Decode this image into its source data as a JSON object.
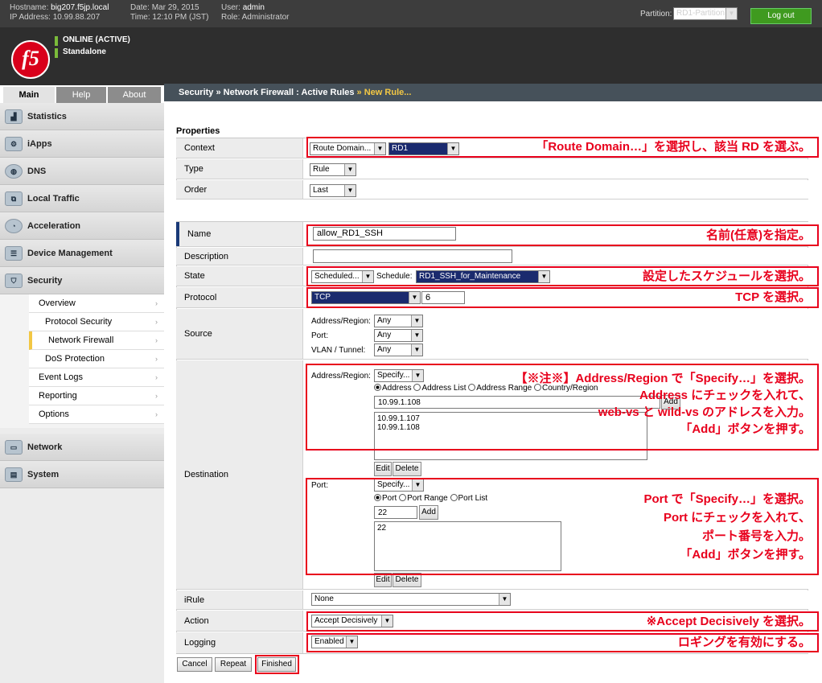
{
  "header": {
    "hostname_label": "Hostname:",
    "hostname": "big207.f5jp.local",
    "ip_label": "IP Address:",
    "ip": "10.99.88.207",
    "date_label": "Date:",
    "date": "Mar 29, 2015",
    "time_label": "Time:",
    "time": "12:10 PM (JST)",
    "user_label": "User:",
    "user": "admin",
    "role_label": "Role:",
    "role": "Administrator",
    "partition_label": "Partition:",
    "partition": "RD1-Partition",
    "logout": "Log out",
    "logo": "f5",
    "status1": "ONLINE (ACTIVE)",
    "status2": "Standalone"
  },
  "tabs": [
    "Main",
    "Help",
    "About"
  ],
  "breadcrumb": {
    "a": "Security",
    "sep1": "»",
    "b": "Network Firewall : Active Rules",
    "sep2": "»",
    "c": "New Rule..."
  },
  "sidebar": {
    "items": [
      "Statistics",
      "iApps",
      "DNS",
      "Local Traffic",
      "Acceleration",
      "Device Management",
      "Security",
      "Network",
      "System"
    ],
    "sub": [
      "Overview",
      "Protocol Security",
      "Network Firewall",
      "DoS Protection",
      "Event Logs",
      "Reporting",
      "Options"
    ]
  },
  "form": {
    "section": "Properties",
    "context": {
      "label": "Context",
      "select1": "Route Domain...",
      "select2": "RD1"
    },
    "type": {
      "label": "Type",
      "value": "Rule"
    },
    "order": {
      "label": "Order",
      "value": "Last"
    },
    "name": {
      "label": "Name",
      "value": "allow_RD1_SSH"
    },
    "description": {
      "label": "Description",
      "value": ""
    },
    "state": {
      "label": "State",
      "value": "Scheduled...",
      "schedule_label": "Schedule:",
      "schedule": "RD1_SSH_for_Maintenance"
    },
    "protocol": {
      "label": "Protocol",
      "value": "TCP",
      "number": "6"
    },
    "source": {
      "label": "Source",
      "addr_label": "Address/Region:",
      "addr": "Any",
      "port_label": "Port:",
      "port": "Any",
      "vlan_label": "VLAN / Tunnel:",
      "vlan": "Any"
    },
    "destination": {
      "label": "Destination",
      "addr_label": "Address/Region:",
      "addr": "Specify...",
      "radios": [
        "Address",
        "Address List",
        "Address Range",
        "Country/Region"
      ],
      "addr_input": "10.99.1.108",
      "add": "Add",
      "list": [
        "10.99.1.107",
        "10.99.1.108"
      ],
      "edit": "Edit",
      "delete": "Delete",
      "port_label": "Port:",
      "port": "Specify...",
      "port_radios": [
        "Port",
        "Port Range",
        "Port List"
      ],
      "port_input": "22",
      "port_list": [
        "22"
      ]
    },
    "irule": {
      "label": "iRule",
      "value": "None"
    },
    "action": {
      "label": "Action",
      "value": "Accept Decisively"
    },
    "logging": {
      "label": "Logging",
      "value": "Enabled"
    },
    "buttons": {
      "cancel": "Cancel",
      "repeat": "Repeat",
      "finished": "Finished"
    }
  },
  "annotations": {
    "context": "「Route Domain…」を選択し、該当 RD を選ぶ。",
    "name": "名前(任意)を指定。",
    "state": "設定したスケジュールを選択。",
    "protocol": "TCP を選択。",
    "dest1": "【※注※】Address/Region で「Specify…」を選択。",
    "dest2": "Address にチェックを入れて、",
    "dest3": "web-vs と wild-vs のアドレスを入力。",
    "dest4": "「Add」ボタンを押す。",
    "port1": "Port で「Specify…」を選択。",
    "port2": "Port にチェックを入れて、",
    "port3": "ポート番号を入力。",
    "port4": "「Add」ボタンを押す。",
    "action": "※Accept Decisively を選択。",
    "logging": "ロギングを有効にする。"
  },
  "colors": {
    "annotation": "#e8001c",
    "accent": "#f2c744",
    "logout": "#3f9a1f"
  }
}
